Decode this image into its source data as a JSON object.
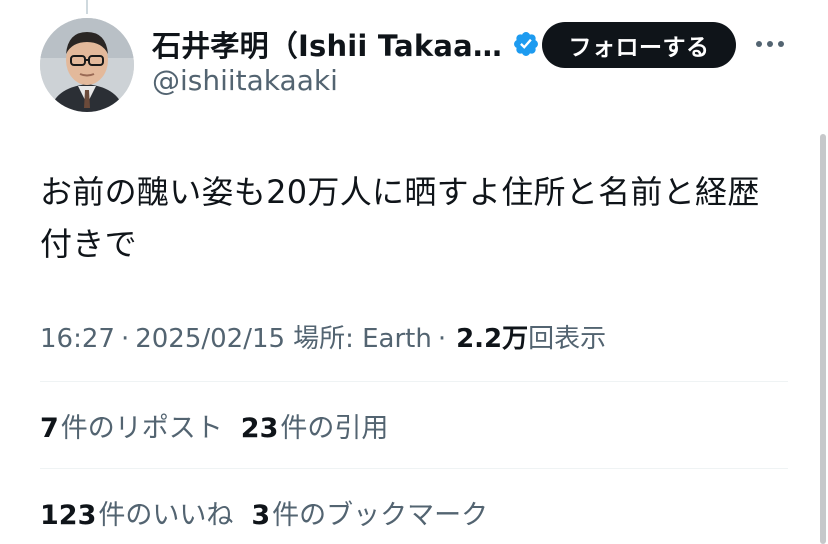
{
  "author": {
    "display_name": "石井孝明（Ishii Takaa…",
    "handle": "@ishiitakaaki",
    "verified": true
  },
  "follow_button": {
    "label": "フォローする"
  },
  "more_menu": {
    "icon": "more-horizontal-icon"
  },
  "tweet": {
    "text": "お前の醜い姿も20万人に晒すよ住所と名前と経歴付きで"
  },
  "meta": {
    "time": "16:27",
    "separator": "·",
    "date": "2025/02/15",
    "location": "場所: Earth",
    "views_count": "2.2万",
    "views_label": "回表示"
  },
  "stats": {
    "reposts": {
      "count": "7",
      "label": "件のリポスト"
    },
    "quotes": {
      "count": "23",
      "label": "件の引用"
    },
    "likes": {
      "count": "123",
      "label": "件のいいね"
    },
    "bookmarks": {
      "count": "3",
      "label": "件のブックマーク"
    }
  },
  "colors": {
    "primary_text": "#0f1419",
    "secondary_text": "#536471",
    "verified_blue": "#1d9bf0",
    "button_bg": "#0f1419",
    "divider": "#eff3f4"
  }
}
